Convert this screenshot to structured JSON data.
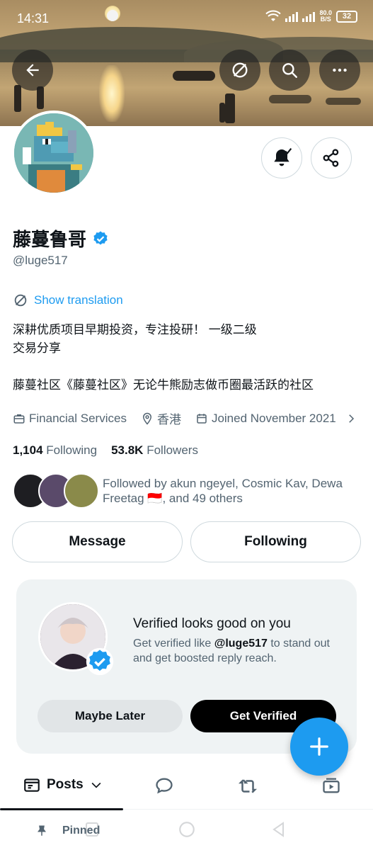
{
  "status_bar": {
    "time": "14:31",
    "net_speed_value": "80.0",
    "net_speed_unit": "B/S",
    "battery": "32"
  },
  "profile": {
    "name": "藤蔓鲁哥",
    "handle": "@luge517",
    "show_translation": "Show translation",
    "bio_line1": "深耕优质项目早期投资，专注投研！ 一级二级",
    "bio_line2": "交易分享",
    "bio_line3": "藤蔓社区《藤蔓社区》无论牛熊励志做币圈最活跃的社区",
    "category": "Financial Services",
    "location": "香港",
    "joined": "Joined November 2021",
    "following_count": "1,104",
    "following_label": "Following",
    "followers_count": "53.8K",
    "followers_label": "Followers",
    "followed_by_text": "Followed by akun ngeyel, Cosmic Kav, Dewa Freetag 🇮🇩, and 49 others"
  },
  "actions": {
    "message": "Message",
    "following": "Following"
  },
  "verified_card": {
    "title": "Verified looks good on you",
    "desc_prefix": "Get verified like ",
    "desc_handle": "@luge517",
    "desc_suffix": " to stand out and get boosted reply reach.",
    "maybe_later": "Maybe Later",
    "get_verified": "Get Verified"
  },
  "tabs": {
    "posts": "Posts"
  },
  "pinned": {
    "label": "Pinned"
  },
  "colors": {
    "accent": "#1d9bf0",
    "text": "#0f1419",
    "secondary": "#536471",
    "card_bg": "#eff3f4"
  }
}
